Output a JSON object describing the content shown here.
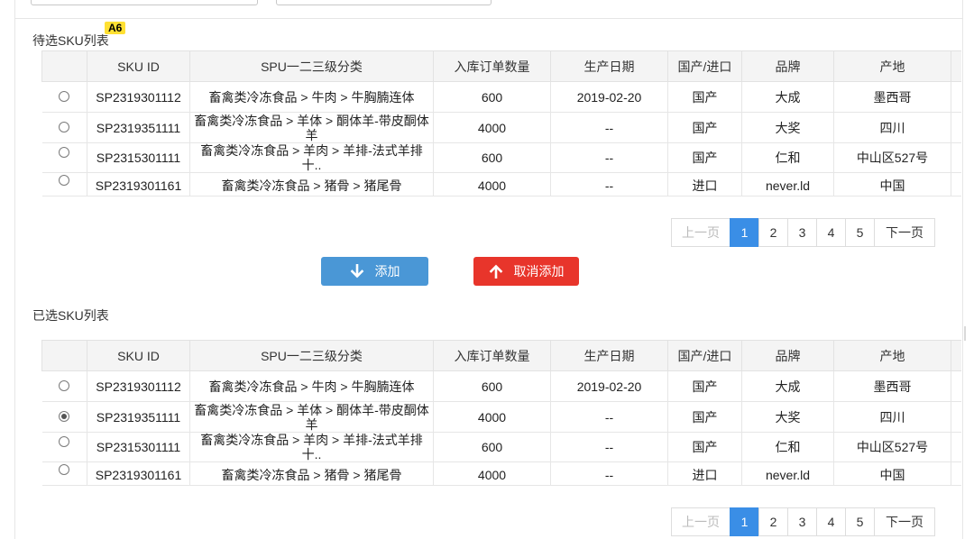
{
  "badge": "A6",
  "pending": {
    "title": "待选SKU列表",
    "rows_selected": [
      false,
      false,
      false,
      false
    ]
  },
  "selected": {
    "title": "已选SKU列表",
    "rows_selected": [
      false,
      true,
      false,
      false
    ]
  },
  "columns": [
    "SKU ID",
    "SPU一二三级分类",
    "入库订单数量",
    "生产日期",
    "国产/进口",
    "品牌",
    "产地"
  ],
  "rows": [
    {
      "sku": "SP2319301112",
      "spu": "畜禽类冷冻食品 > 牛肉 > 牛胸腩连体",
      "qty": "600",
      "date": "2019-02-20",
      "origin_type": "国产",
      "brand": "大成",
      "place": "墨西哥"
    },
    {
      "sku": "SP2319351111",
      "spu": "畜禽类冷冻食品 > 羊体 > 酮体羊-带皮酮体羊",
      "qty": "4000",
      "date": "--",
      "origin_type": "国产",
      "brand": "大奖",
      "place": "四川"
    },
    {
      "sku": "SP2315301111",
      "spu": "畜禽类冷冻食品 > 羊肉 > 羊排-法式羊排十..",
      "qty": "600",
      "date": "--",
      "origin_type": "国产",
      "brand": "仁和",
      "place": "中山区527号"
    },
    {
      "sku": "SP2319301161",
      "spu": "畜禽类冷冻食品 > 猪骨 > 猪尾骨",
      "qty": "4000",
      "date": "--",
      "origin_type": "进口",
      "brand": "never.ld",
      "place": "中国"
    }
  ],
  "pagination": {
    "prev": "上一页",
    "pages": [
      "1",
      "2",
      "3",
      "4",
      "5"
    ],
    "active": "1",
    "next": "下一页"
  },
  "buttons": {
    "add": "添加",
    "cancel": "取消添加"
  },
  "colors": {
    "primary": "#3a8ee6",
    "add_button": "#4a97d6",
    "cancel_button": "#e8352b",
    "badge": "#ffe033"
  },
  "icons": {
    "add": "arrow-down-icon",
    "cancel": "arrow-up-icon"
  }
}
